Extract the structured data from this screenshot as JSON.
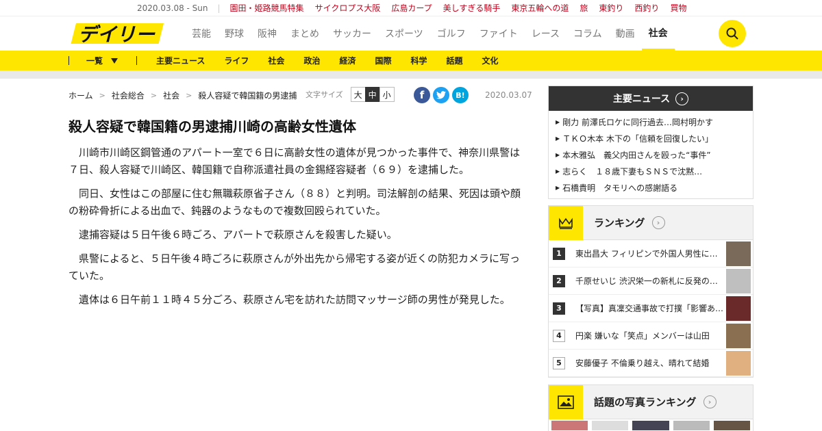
{
  "topbar": {
    "date": "2020.03.08 - Sun",
    "links": [
      "園田・姫路競馬特集",
      "サイクロプス大阪",
      "広島カープ",
      "美しすぎる騎手",
      "東京五輪への道",
      "旅",
      "東釣り",
      "西釣り",
      "買物"
    ]
  },
  "header": {
    "logo": "デイリー",
    "nav": [
      "芸能",
      "野球",
      "阪神",
      "まとめ",
      "サッカー",
      "スポーツ",
      "ゴルフ",
      "ファイト",
      "レース",
      "コラム",
      "動画",
      "社会"
    ],
    "active_nav": "社会"
  },
  "subnav": {
    "ichiran": "一覧",
    "items": [
      "主要ニュース",
      "ライフ",
      "社会",
      "政治",
      "経済",
      "国際",
      "科学",
      "話題",
      "文化"
    ]
  },
  "breadcrumb": [
    "ホーム",
    "社会総合",
    "社会",
    "殺人容疑で韓国籍の男逮捕"
  ],
  "fontsize": {
    "label": "文字サイズ",
    "large": "大",
    "medium": "中",
    "small": "小"
  },
  "share": {
    "facebook": "f",
    "twitter": "t",
    "hatena": "B!"
  },
  "article": {
    "date": "2020.03.07",
    "title": "殺人容疑で韓国籍の男逮捕川崎の高齢女性遺体",
    "paragraphs": [
      "川崎市川崎区鋼管通のアパート一室で６日に高齢女性の遺体が見つかった事件で、神奈川県警は７日、殺人容疑で川崎区、韓国籍で自称派遣社員の金錫経容疑者（６９）を逮捕した。",
      "同日、女性はこの部屋に住む無職萩原省子さん（８８）と判明。司法解剖の結果、死因は頭や顔の粉砕骨折による出血で、鈍器のようなもので複数回殴られていた。",
      "逮捕容疑は５日午後６時ごろ、アパートで萩原さんを殺害した疑い。",
      "県警によると、５日午後４時ごろに萩原さんが外出先から帰宅する姿が近くの防犯カメラに写っていた。",
      "遺体は６日午前１１時４５分ごろ、萩原さん宅を訪れた訪問マッサージ師の男性が発見した。"
    ]
  },
  "sidebar": {
    "news": {
      "title": "主要ニュース",
      "items": [
        "剛力 前澤氏ロケに同行過去…岡村明かす",
        "ＴＫＯ木本 木下の「信頼を回復したい」",
        "本木雅弘　義父内田さんを殴った“事件”",
        "志らく　１８歳下妻もＳＮＳで沈黙…",
        "石橋貴明　タモリへの感謝語る"
      ]
    },
    "ranking": {
      "title": "ランキング",
      "items": [
        {
          "num": "1",
          "text": "東出昌大 フィリピンで外国人男性に…"
        },
        {
          "num": "2",
          "text": "千原せいじ 渋沢栄一の新札に反発の…"
        },
        {
          "num": "3",
          "text": "【写真】真凜交通事故で打撲「影響あ…"
        },
        {
          "num": "4",
          "text": "円楽 嫌いな「笑点」メンバーは山田"
        },
        {
          "num": "5",
          "text": "安藤優子 不倫乗り越え、晴れて結婚"
        }
      ]
    },
    "photo_ranking": {
      "title": "話題の写真ランキング"
    }
  },
  "colors": {
    "brand_yellow": "#ffe600",
    "link_red": "#c0001a",
    "dark": "#333333",
    "facebook": "#3b5998",
    "twitter": "#1da1f2",
    "hatena": "#00a4de"
  }
}
